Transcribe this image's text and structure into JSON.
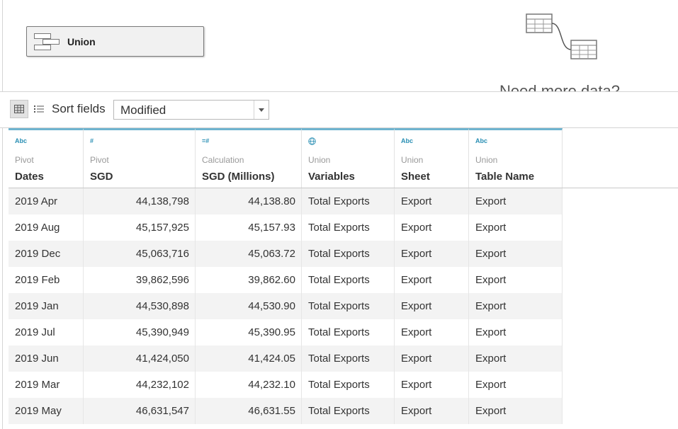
{
  "canvas": {
    "union_label": "Union",
    "need_more_text": "Need more data?"
  },
  "toolbar": {
    "sort_label": "Sort fields",
    "sort_value": "Modified"
  },
  "columns": [
    {
      "type": "Abc",
      "origin": "Pivot",
      "name": "Dates"
    },
    {
      "type": "#",
      "origin": "Pivot",
      "name": "SGD"
    },
    {
      "type": "=#",
      "origin": "Calculation",
      "name": "SGD (Millions)"
    },
    {
      "type": "globe",
      "origin": "Union",
      "name": "Variables"
    },
    {
      "type": "Abc",
      "origin": "Union",
      "name": "Sheet"
    },
    {
      "type": "Abc",
      "origin": "Union",
      "name": "Table Name"
    }
  ],
  "rows": [
    [
      "2019 Apr",
      "44,138,798",
      "44,138.80",
      "Total Exports",
      "Export",
      "Export"
    ],
    [
      "2019 Aug",
      "45,157,925",
      "45,157.93",
      "Total Exports",
      "Export",
      "Export"
    ],
    [
      "2019 Dec",
      "45,063,716",
      "45,063.72",
      "Total Exports",
      "Export",
      "Export"
    ],
    [
      "2019 Feb",
      "39,862,596",
      "39,862.60",
      "Total Exports",
      "Export",
      "Export"
    ],
    [
      "2019 Jan",
      "44,530,898",
      "44,530.90",
      "Total Exports",
      "Export",
      "Export"
    ],
    [
      "2019 Jul",
      "45,390,949",
      "45,390.95",
      "Total Exports",
      "Export",
      "Export"
    ],
    [
      "2019 Jun",
      "41,424,050",
      "41,424.05",
      "Total Exports",
      "Export",
      "Export"
    ],
    [
      "2019 Mar",
      "44,232,102",
      "44,232.10",
      "Total Exports",
      "Export",
      "Export"
    ],
    [
      "2019 May",
      "46,631,547",
      "46,631.55",
      "Total Exports",
      "Export",
      "Export"
    ]
  ],
  "colors": {
    "accent": "#6fb4cf",
    "type_icon": "#2a8fb4",
    "row_alt": "#f3f3f3"
  }
}
